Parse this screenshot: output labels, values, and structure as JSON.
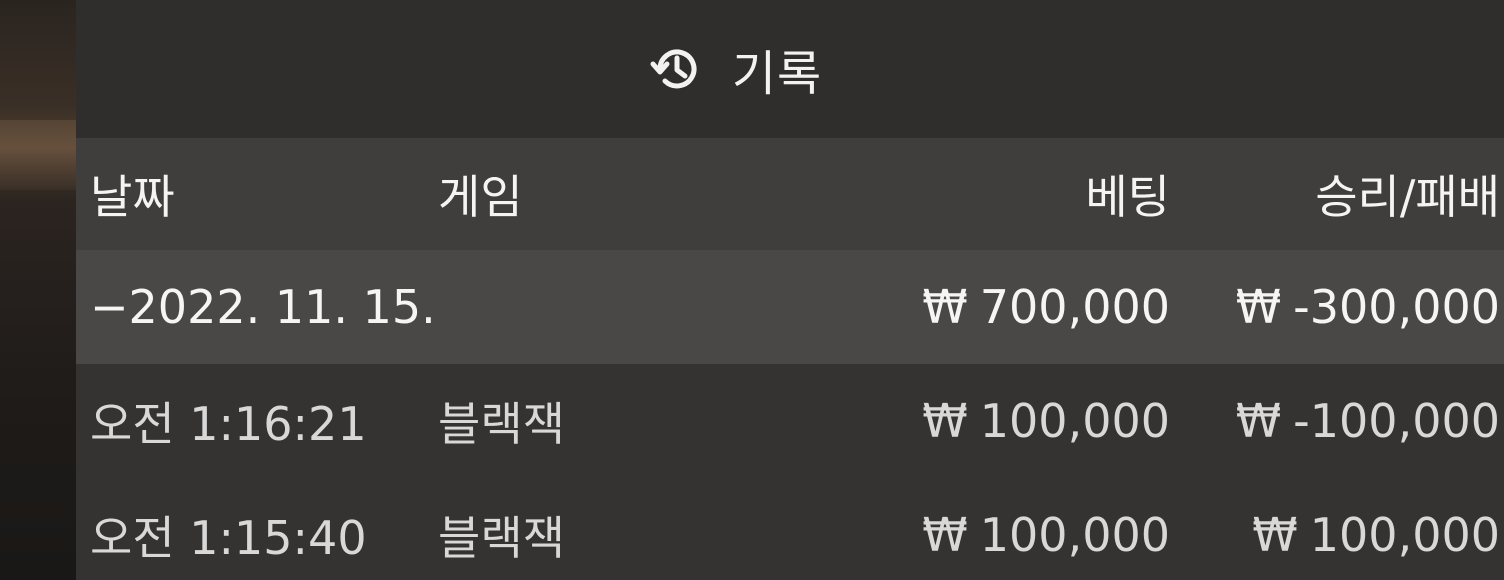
{
  "header": {
    "icon": "history-icon",
    "title": "기록"
  },
  "columns": {
    "date": "날짜",
    "game": "게임",
    "bet": "베팅",
    "win_loss": "승리/패배"
  },
  "currency_symbol": "₩",
  "day_group": {
    "date": "−2022. 11. 15.",
    "bet": "700,000",
    "win_loss": "-300,000"
  },
  "entries": [
    {
      "time": "오전 1:16:21",
      "game": "블랙잭",
      "bet": "100,000",
      "win_loss": "-100,000"
    },
    {
      "time": "오전 1:15:40",
      "game": "블랙잭",
      "bet": "100,000",
      "win_loss": "100,000"
    }
  ],
  "colors": {
    "panel_bg": "#353331",
    "header_bg": "#302e2c",
    "column_header_bg": "#403e3c",
    "day_row_bg": "#4a4846",
    "text": "#f2f2f2"
  }
}
